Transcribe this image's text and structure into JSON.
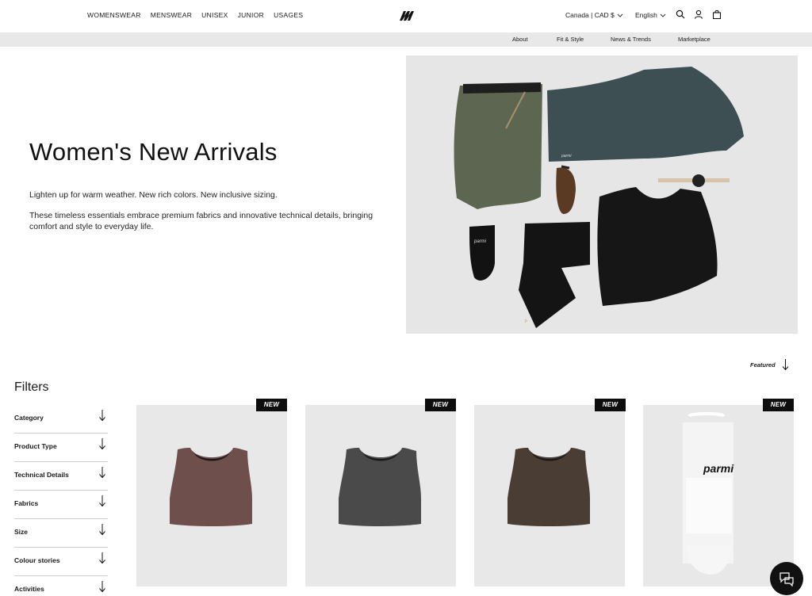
{
  "header": {
    "nav": [
      "WOMENSWEAR",
      "MENSWEAR",
      "UNISEX",
      "JUNIOR",
      "USAGES"
    ],
    "locale": "Canada | CAD $",
    "language": "English",
    "icons": [
      "search-icon",
      "account-icon",
      "bag-icon"
    ]
  },
  "subnav": [
    "About",
    "Fit & Style",
    "News & Trends",
    "Marketplace"
  ],
  "hero": {
    "title": "Women's New Arrivals",
    "p1": "Lighten up for warm weather. New rich colors. New inclusive sizing.",
    "p2": "These timeless essentials embrace premium fabrics and innovative technical details, bringing comfort and style to everyday life."
  },
  "sort": {
    "label": "Featured"
  },
  "filters": {
    "title": "Filters",
    "items": [
      "Category",
      "Product Type",
      "Technical Details",
      "Fabrics",
      "Size",
      "Colour stories",
      "Activities"
    ]
  },
  "products": [
    {
      "badge": "NEW",
      "color": "#6e4f4c"
    },
    {
      "badge": "NEW",
      "color": "#4a4a4a"
    },
    {
      "badge": "NEW",
      "color": "#4a3d33"
    },
    {
      "badge": "NEW",
      "brand": "parmi"
    }
  ],
  "colors": {
    "hero_bg": "#e6e6e6",
    "card_bg": "#e8e8e8",
    "subbar": "#e8e8e8"
  }
}
